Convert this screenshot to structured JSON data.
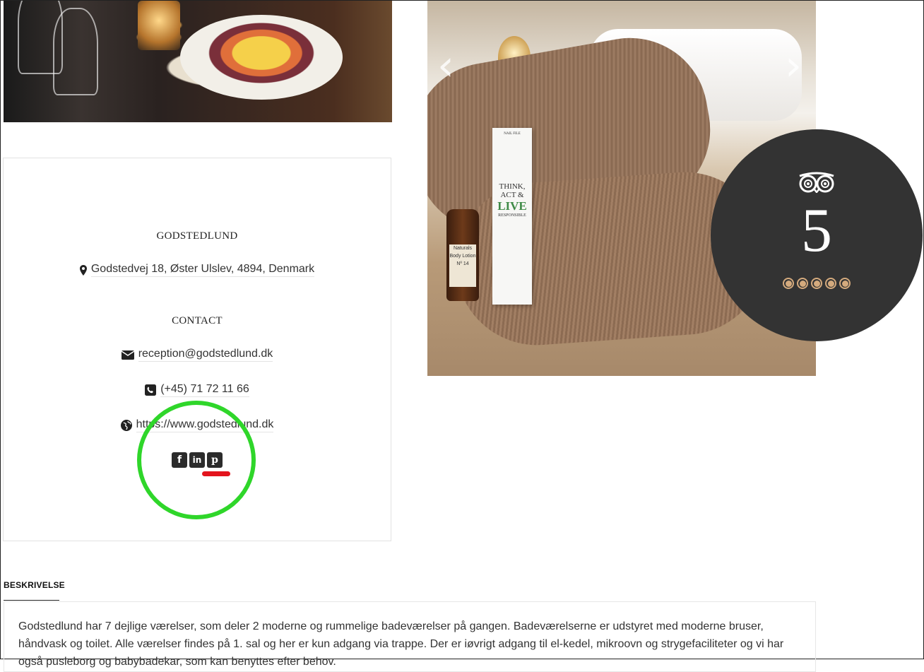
{
  "hotel": {
    "name": "GODSTEDLUND",
    "address": "Godstedvej 18, Øster Ulslev, 4894, Denmark"
  },
  "contact": {
    "heading": "CONTACT",
    "email": "reception@godstedlund.dk",
    "phone": "(+45) 71 72 11 66",
    "website": "https://www.godstedlund.dk"
  },
  "socials": [
    {
      "name": "facebook",
      "glyph": "f"
    },
    {
      "name": "linkedin",
      "glyph": "in"
    },
    {
      "name": "pinterest",
      "glyph": "p"
    }
  ],
  "photo_bed": {
    "box_title": "THINK,\nACT &",
    "box_live": "LIVE",
    "box_sub": "RESPONSIBLE",
    "box_top": "NAIL FILE",
    "bottle_label": "Naturals\nBody Lotion\nNº 14"
  },
  "rating": {
    "provider": "tripadvisor",
    "score": "5",
    "dots_filled": 5,
    "dots_total": 5,
    "accent": "#d4aa7d"
  },
  "description": {
    "tab_label": "BESKRIVELSE",
    "text": "Godstedlund har 7 dejlige værelser, som deler 2 moderne og rummelige badeværelser på gangen.  Badeværelserne er udstyret med moderne bruser, håndvask og toilet.  Alle værelser findes på 1. sal og her er kun adgang via trappe.  Der er iøvrigt adgang til el-kedel, mikroovn og strygefaciliteter og vi har også pusleborg og babybadekar, som kan benyttes efter behov."
  },
  "annotations": {
    "highlight_color": "#2fd62a",
    "underline_color": "#e3141d"
  }
}
